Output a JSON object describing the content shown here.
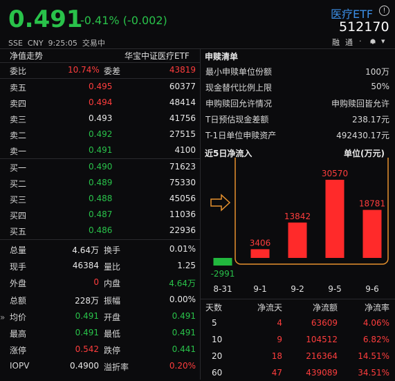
{
  "header": {
    "price": "0.491",
    "change": "-0.41% (-0.002)",
    "market_line": "SSE  CNY  9:25:05  交易中",
    "name": "医疗ETF",
    "code": "512170",
    "info_icon": "info-circle-icon",
    "tool_labels": [
      "融",
      "通"
    ]
  },
  "left": {
    "section_left": "净值走势",
    "section_right": "华宝中证医疗ETF",
    "weibi": {
      "label": "委比",
      "pct": "10.74%",
      "label2": "委差",
      "value": "43819"
    },
    "asks": [
      {
        "label": "卖五",
        "price": "0.495",
        "vol": "60377",
        "color": "up"
      },
      {
        "label": "卖四",
        "price": "0.494",
        "vol": "48414",
        "color": "up"
      },
      {
        "label": "卖三",
        "price": "0.493",
        "vol": "41756",
        "color": "white"
      },
      {
        "label": "卖二",
        "price": "0.492",
        "vol": "27515",
        "color": "down"
      },
      {
        "label": "卖一",
        "price": "0.491",
        "vol": "4100",
        "color": "down"
      }
    ],
    "bids": [
      {
        "label": "买一",
        "price": "0.490",
        "vol": "71623",
        "color": "down"
      },
      {
        "label": "买二",
        "price": "0.489",
        "vol": "75330",
        "color": "down"
      },
      {
        "label": "买三",
        "price": "0.488",
        "vol": "45056",
        "color": "down"
      },
      {
        "label": "买四",
        "price": "0.487",
        "vol": "11036",
        "color": "down"
      },
      {
        "label": "买五",
        "price": "0.486",
        "vol": "22936",
        "color": "down"
      }
    ],
    "stats": [
      {
        "l1": "总量",
        "v1": "4.64万",
        "c1": "white",
        "l2": "换手",
        "v2": "0.01%",
        "c2": "white"
      },
      {
        "l1": "现手",
        "v1": "46384",
        "c1": "white",
        "l2": "量比",
        "v2": "1.25",
        "c2": "white"
      },
      {
        "l1": "外盘",
        "v1": "0",
        "c1": "up",
        "l2": "内盘",
        "v2": "4.64万",
        "c2": "down"
      },
      {
        "l1": "总额",
        "v1": "228万",
        "c1": "white",
        "l2": "振幅",
        "v2": "0.00%",
        "c2": "white"
      },
      {
        "l1": "均价",
        "v1": "0.491",
        "c1": "down",
        "l2": "开盘",
        "v2": "0.491",
        "c2": "down"
      },
      {
        "l1": "最高",
        "v1": "0.491",
        "c1": "down",
        "l2": "最低",
        "v2": "0.491",
        "c2": "down"
      },
      {
        "l1": "涨停",
        "v1": "0.542",
        "c1": "up",
        "l2": "跌停",
        "v2": "0.441",
        "c2": "down"
      },
      {
        "l1": "IOPV",
        "v1": "0.4900",
        "c1": "white",
        "l2": "溢折率",
        "v2": "0.20%",
        "c2": "up"
      }
    ]
  },
  "right": {
    "title": "申赎清单",
    "items": [
      {
        "label": "最小申赎单位份额",
        "value": "100万"
      },
      {
        "label": "现金替代比例上限",
        "value": "50%"
      },
      {
        "label": "申购赎回允许情况",
        "value": "申购赎回皆允许"
      },
      {
        "label": "T日预估现金差额",
        "value": "238.17元"
      },
      {
        "label": "T-1日单位申赎资产",
        "value": "492430.17元"
      }
    ],
    "chart_title": "近5日净流入",
    "chart_unit": "单位(万元)",
    "table_headers": [
      "天数",
      "净流天",
      "净流额",
      "净流率"
    ],
    "table_rows": [
      [
        "5",
        "4",
        "63609",
        "4.06%"
      ],
      [
        "10",
        "9",
        "104512",
        "6.82%"
      ],
      [
        "20",
        "18",
        "216364",
        "14.51%"
      ],
      [
        "60",
        "47",
        "439089",
        "34.51%"
      ]
    ]
  },
  "colors": {
    "up": "#ff3d3d",
    "down": "#29c24a",
    "highlight": "#e8922e",
    "link": "#3b8fe8"
  },
  "chart_data": {
    "type": "bar",
    "categories": [
      "8-31",
      "9-1",
      "9-2",
      "9-5",
      "9-6"
    ],
    "values": [
      -2991,
      3406,
      13842,
      30570,
      18781
    ],
    "title": "近5日净流入",
    "ylabel": "单位(万元)",
    "ylim": [
      -4000,
      33000
    ]
  }
}
